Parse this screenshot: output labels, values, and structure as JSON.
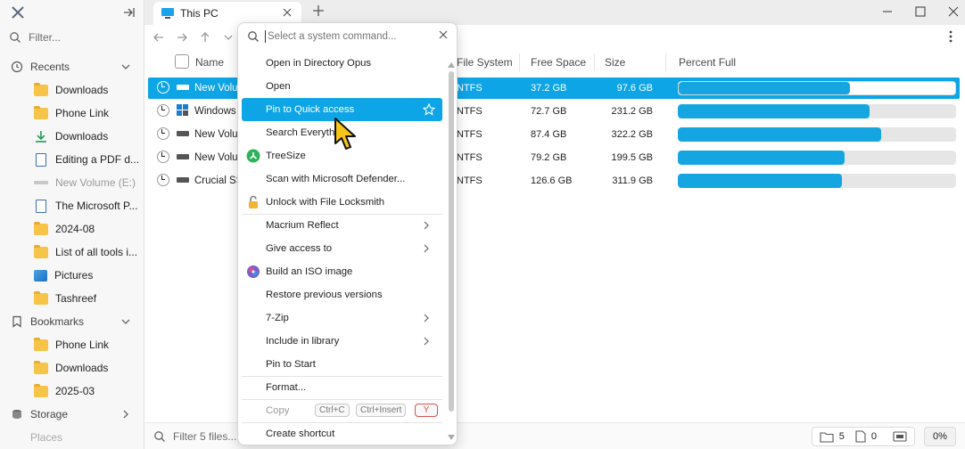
{
  "window": {
    "tab_title": "This PC"
  },
  "sidebar": {
    "filter_placeholder": "Filter...",
    "sections": [
      {
        "label": "Recents"
      },
      {
        "label": "Bookmarks"
      },
      {
        "label": "Storage"
      },
      {
        "label": "Places"
      }
    ],
    "recents": [
      {
        "label": "Downloads",
        "icon": "folder-icon"
      },
      {
        "label": "Phone Link",
        "icon": "folder-icon"
      },
      {
        "label": "Downloads",
        "icon": "download-arrow-icon"
      },
      {
        "label": "Editing a PDF d...",
        "icon": "document-icon"
      },
      {
        "label": "New Volume (E:)",
        "icon": "drive-icon"
      },
      {
        "label": "The Microsoft P...",
        "icon": "document-icon"
      },
      {
        "label": "2024-08",
        "icon": "folder-icon"
      },
      {
        "label": "List of all tools i...",
        "icon": "folder-icon"
      },
      {
        "label": "Pictures",
        "icon": "pictures-icon"
      },
      {
        "label": "Tashreef",
        "icon": "folder-icon"
      }
    ],
    "bookmarks": [
      {
        "label": "Phone Link",
        "icon": "folder-icon"
      },
      {
        "label": "Downloads",
        "icon": "folder-icon"
      },
      {
        "label": "2025-03",
        "icon": "folder-icon"
      }
    ]
  },
  "columns": {
    "name": "Name",
    "file_system": "File System",
    "free_space": "Free Space",
    "size": "Size",
    "percent_full": "Percent Full"
  },
  "drives": [
    {
      "name": "New Volu",
      "fs": "NTFS",
      "free": "37.2 GB",
      "size": "97.6 GB",
      "percent": 0.62
    },
    {
      "name": "Windows",
      "fs": "NTFS",
      "free": "72.7 GB",
      "size": "231.2 GB",
      "percent": 0.69
    },
    {
      "name": "New Volu",
      "fs": "NTFS",
      "free": "87.4 GB",
      "size": "322.2 GB",
      "percent": 0.73
    },
    {
      "name": "New Volu",
      "fs": "NTFS",
      "free": "79.2 GB",
      "size": "199.5 GB",
      "percent": 0.6
    },
    {
      "name": "Crucial SS",
      "fs": "NTFS",
      "free": "126.6 GB",
      "size": "311.9 GB",
      "percent": 0.59
    }
  ],
  "palette": {
    "placeholder": "Select a system command...",
    "items": [
      {
        "label": "Open in Directory Opus"
      },
      {
        "label": "Open"
      },
      {
        "label": "Pin to Quick access"
      },
      {
        "label": "Search Everything"
      },
      {
        "label": "TreeSize"
      },
      {
        "label": "Scan with Microsoft Defender..."
      },
      {
        "label": "Unlock with File Locksmith"
      },
      {
        "label": "Macrium Reflect"
      },
      {
        "label": "Give access to"
      },
      {
        "label": "Build an ISO image"
      },
      {
        "label": "Restore previous versions"
      },
      {
        "label": "7-Zip"
      },
      {
        "label": "Include in library"
      },
      {
        "label": "Pin to Start"
      },
      {
        "label": "Format..."
      },
      {
        "label": "Copy"
      },
      {
        "label": "Create shortcut"
      }
    ],
    "copy_shortcuts": [
      "Ctrl+C",
      "Ctrl+Insert",
      "Y"
    ]
  },
  "status": {
    "filter_placeholder": "Filter 5 files...",
    "folder_count": "5",
    "file_count": "0",
    "percent": "0%"
  },
  "colors": {
    "accent": "#0ea5e6",
    "bar_fill": "#15a6e2"
  }
}
